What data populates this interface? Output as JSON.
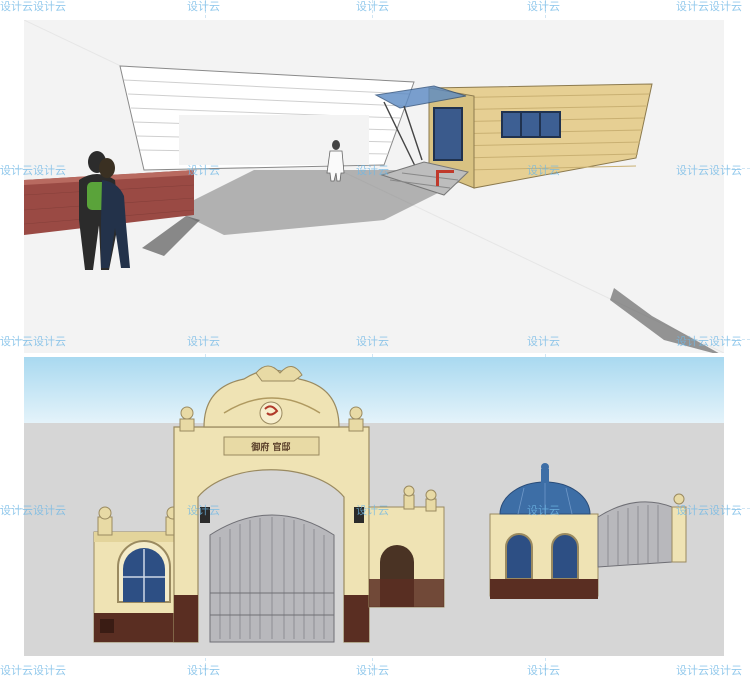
{
  "watermark": {
    "text": "设计云",
    "text_double": "设计云设计云"
  },
  "top_scene": {
    "name": "guard-booth-model"
  },
  "bottom_scene": {
    "name": "european-gate-model",
    "sign_text": "御府 官邸"
  },
  "colors": {
    "sky": "#bfe3f4",
    "ground": "#d8d8d8",
    "cream_wall": "#efe3b4",
    "dark_brick": "#5a2e22",
    "dome_blue": "#3d6ea6",
    "iron_gate": "#b8b8bc"
  }
}
